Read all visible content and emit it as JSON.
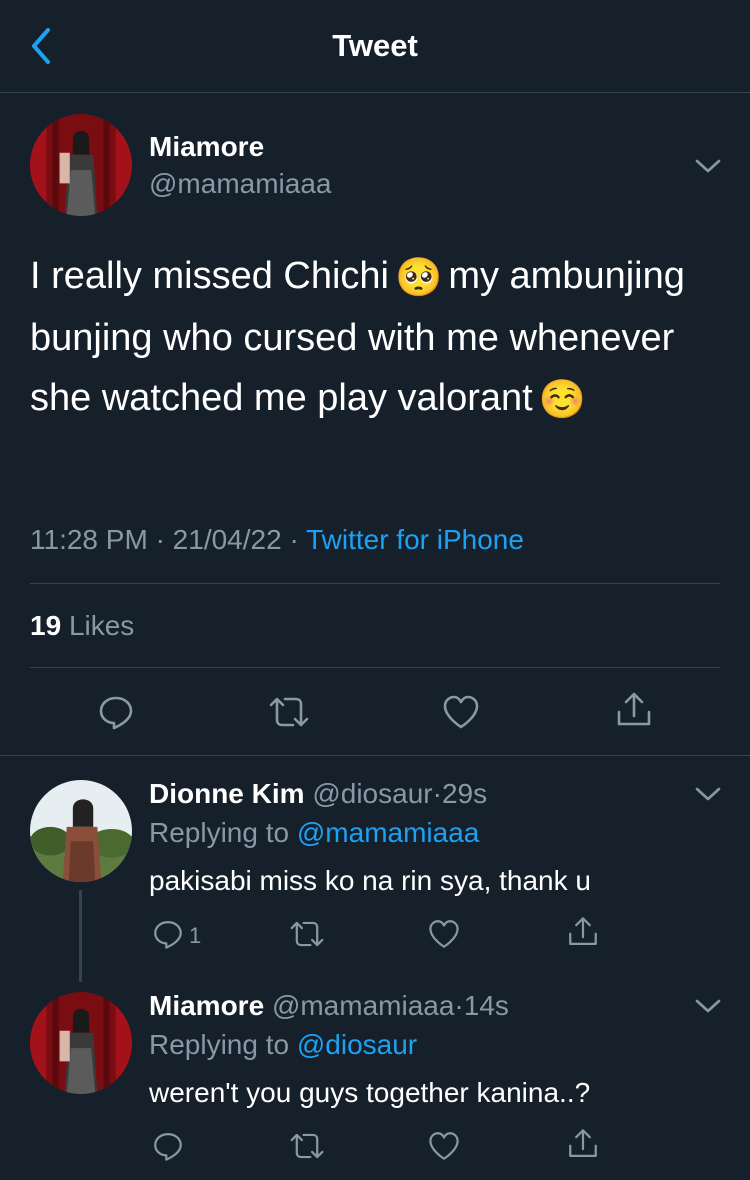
{
  "header": {
    "title": "Tweet"
  },
  "tweet": {
    "name": "Miamore",
    "handle": "@mamamiaaa",
    "text_part1": "I really missed Chichi",
    "emoji1": "🥺",
    "text_part2": "my ambunjing bunjing who cursed with me whenever she watched me play valorant",
    "emoji2": "☺️",
    "time": "11:28 PM",
    "date": "21/04/22",
    "source": "Twitter for iPhone",
    "likes_count": "19",
    "likes_label": "Likes"
  },
  "replies": [
    {
      "name": "Dionne Kim",
      "handle": "@diosaur",
      "age": "29s",
      "replying_label": "Replying to",
      "replying_to": "@mamamiaaa",
      "text": "pakisabi miss ko na rin sya, thank u",
      "reply_count": "1"
    },
    {
      "name": "Miamore",
      "handle": "@mamamiaaa",
      "age": "14s",
      "replying_label": "Replying to",
      "replying_to": "@diosaur",
      "text": "weren't you guys together kanina..?"
    }
  ],
  "separator_dot": "·",
  "icons": [
    "back-chevron-icon",
    "chevron-down-icon",
    "reply-icon",
    "retweet-icon",
    "like-icon",
    "share-icon"
  ],
  "colors": {
    "background": "#15202b",
    "divider": "#38444d",
    "muted": "#8899a6",
    "accent": "#1da1f2"
  }
}
